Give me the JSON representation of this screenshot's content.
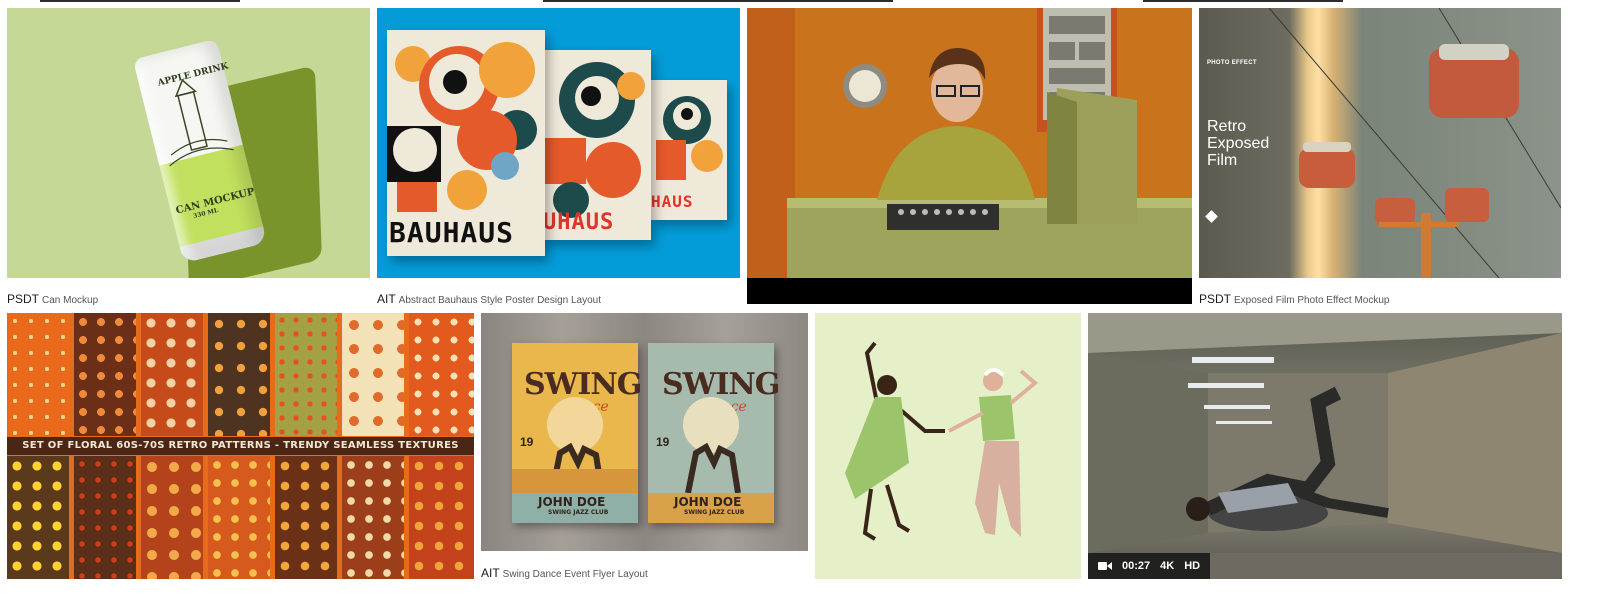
{
  "row1": [
    {
      "type": "PSDT",
      "title": "Can Mockup"
    },
    {
      "type": "AIT",
      "title": "Abstract Bauhaus Style Poster Design Layout"
    },
    {
      "type": "",
      "title": ""
    },
    {
      "type": "PSDT",
      "title": "Exposed Film Photo Effect Mockup"
    }
  ],
  "row2": [
    {
      "type": "",
      "title": ""
    },
    {
      "type": "AIT",
      "title": "Swing Dance Event Flyer Layout"
    },
    {
      "type": "",
      "title": ""
    },
    {
      "type": "",
      "title": ""
    }
  ],
  "can": {
    "brand": "APPLE DRINK",
    "label": "CAN MOCKUP",
    "volume": "330 ML"
  },
  "bauhaus": {
    "word": "BAUHAUS",
    "word_partial": "UHAUS",
    "word_small": "HAUS"
  },
  "film": {
    "tag": "PHOTO EFFECT",
    "line1": "Retro",
    "line2": "Exposed",
    "line3": "Film"
  },
  "patterns": {
    "banner": "SET OF FLORAL 60S-70S RETRO PATTERNS - TRENDY SEAMLESS TEXTURES"
  },
  "flyer": {
    "title": "SWING",
    "subtitle": "Dance",
    "name": "JOHN DOE",
    "club": "SWING JAZZ CLUB",
    "date": "19"
  },
  "video": {
    "duration": "00:27",
    "res": "4K",
    "quality": "HD"
  },
  "colors": {
    "accent_can": "#c6d896",
    "bauhaus_bg": "#049cd8",
    "dancers_bg": "#e5f0c8"
  }
}
